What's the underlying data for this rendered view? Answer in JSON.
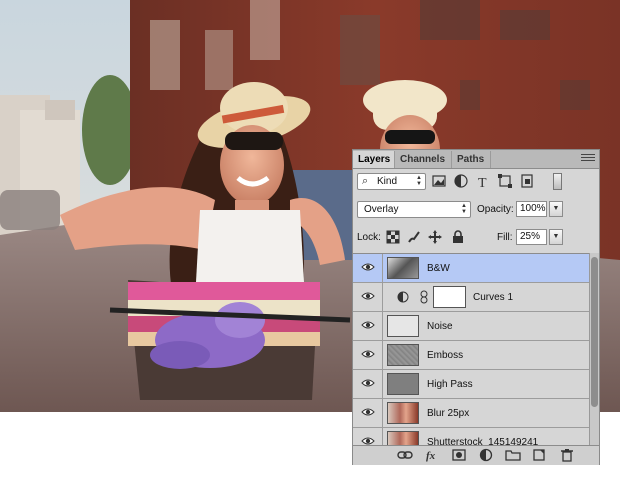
{
  "panel": {
    "tabs": [
      {
        "label": "Layers",
        "active": true
      },
      {
        "label": "Channels",
        "active": false
      },
      {
        "label": "Paths",
        "active": false
      }
    ],
    "filter": {
      "kind_label": "Kind"
    },
    "blend_mode": "Overlay",
    "opacity_label": "Opacity:",
    "opacity_value": "100%",
    "lock_label": "Lock:",
    "fill_label": "Fill:",
    "fill_value": "25%",
    "layers": [
      {
        "name": "B&W",
        "visible": true,
        "selected": true,
        "thumbnail": "bw-photo"
      },
      {
        "name": "Curves 1",
        "visible": true,
        "selected": false,
        "thumbnail": "white-mask"
      },
      {
        "name": "Noise",
        "visible": true,
        "selected": false,
        "thumbnail": "light-gray"
      },
      {
        "name": "Emboss",
        "visible": true,
        "selected": false,
        "thumbnail": "gray-texture"
      },
      {
        "name": "High Pass",
        "visible": true,
        "selected": false,
        "thumbnail": "gray"
      },
      {
        "name": "Blur 25px",
        "visible": true,
        "selected": false,
        "thumbnail": "color-photo"
      },
      {
        "name": "Shutterstock_145149241",
        "visible": true,
        "selected": false,
        "thumbnail": "color-photo"
      }
    ],
    "footer_icons": [
      "link-layers-icon",
      "fx-icon",
      "add-mask-icon",
      "adjustment-layer-icon",
      "new-group-icon",
      "new-layer-icon",
      "trash-icon"
    ]
  },
  "colors": {
    "panel_bg": "#d6d6d6",
    "selection": "#b5c9f5",
    "photo_building": "#8a3a2a"
  }
}
